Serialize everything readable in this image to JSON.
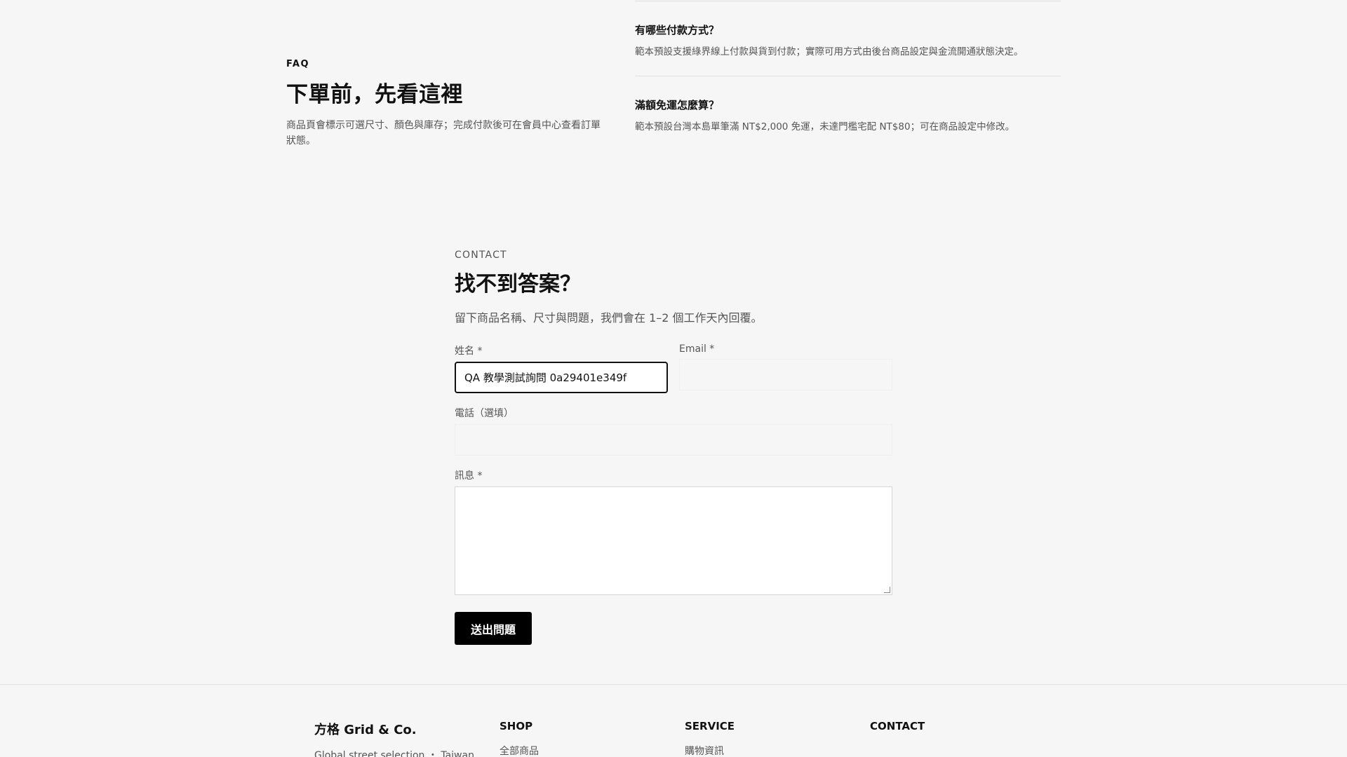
{
  "faq": {
    "eyebrow": "FAQ",
    "title": "下單前，先看這裡",
    "description": "商品頁會標示可選尺寸、顏色與庫存；完成付款後可在會員中心查看訂單狀態。",
    "items": [
      {
        "question": "有哪些付款方式？",
        "answer": "範本預設支援綠界線上付款與貨到付款；實際可用方式由後台商品設定與金流開通狀態決定。"
      },
      {
        "question": "滿額免運怎麼算？",
        "answer": "範本預設台灣本島單筆滿 NT$2,000 免運，未達門檻宅配 NT$80；可在商品設定中修改。"
      }
    ]
  },
  "contact": {
    "eyebrow": "CONTACT",
    "title": "找不到答案？",
    "description": "留下商品名稱、尺寸與問題，我們會在 1–2 個工作天內回覆。",
    "form": {
      "name_label": "姓名 *",
      "name_value": "QA 教學測試詢問 0a29401e349f",
      "email_label": "Email *",
      "email_value": "",
      "phone_label": "電話（選填）",
      "phone_value": "",
      "message_label": "訊息 *",
      "message_value": "",
      "submit_label": "送出問題"
    }
  },
  "footer": {
    "brand_name": "方格 Grid & Co.",
    "brand_tagline": "Global street selection ・ Taiwan",
    "columns": [
      {
        "heading": "SHOP",
        "link": "全部商品"
      },
      {
        "heading": "SERVICE",
        "link": "購物資訊"
      },
      {
        "heading": "CONTACT",
        "link": ""
      }
    ]
  }
}
